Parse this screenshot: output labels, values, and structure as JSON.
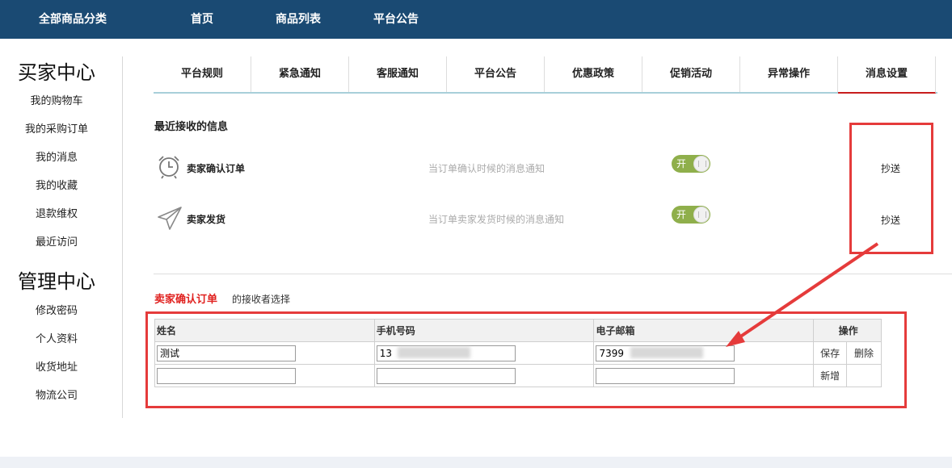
{
  "header": {
    "nav": [
      "全部商品分类",
      "首页",
      "商品列表",
      "平台公告"
    ]
  },
  "sidebar": {
    "buyer_title": "买家中心",
    "buyer_items": [
      "我的购物车",
      "我的采购订单",
      "我的消息",
      "我的收藏",
      "退款维权",
      "最近访问"
    ],
    "manage_title": "管理中心",
    "manage_items": [
      "修改密码",
      "个人资料",
      "收货地址",
      "物流公司"
    ]
  },
  "tabs": [
    "平台规则",
    "紧急通知",
    "客服通知",
    "平台公告",
    "优惠政策",
    "促销活动",
    "异常操作",
    "消息设置"
  ],
  "recent": {
    "title": "最近接收的信息",
    "items": [
      {
        "label": "卖家确认订单",
        "desc": "当订单确认时候的消息通知",
        "toggle": "开",
        "cc": "抄送",
        "icon": "alarm-clock-icon"
      },
      {
        "label": "卖家发货",
        "desc": "当订单卖家发货时候的消息通知",
        "toggle": "开",
        "cc": "抄送",
        "icon": "paper-plane-icon"
      }
    ]
  },
  "receivers": {
    "highlight": "卖家确认订单",
    "rest": "的接收者选择",
    "headers": {
      "name": "姓名",
      "phone": "手机号码",
      "email": "电子邮箱",
      "ops": "操作"
    },
    "rows": [
      {
        "name": "测试",
        "phone": "13",
        "email": "7399",
        "op1": "保存",
        "op2": "删除"
      },
      {
        "name": "",
        "phone": "",
        "email": "",
        "op1": "新增",
        "op2": ""
      }
    ]
  },
  "colors": {
    "header_bg": "#1a4a73",
    "toggle_on": "#8faf4b",
    "highlight": "#e0211f",
    "annotation": "#e53b3b"
  }
}
